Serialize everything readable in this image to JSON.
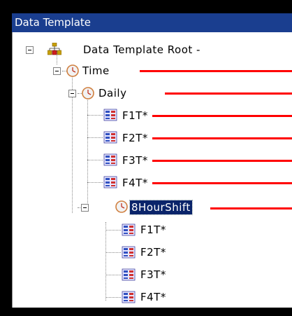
{
  "window": {
    "title": "Data Template"
  },
  "tree": {
    "root": {
      "label": "Data Template Root -",
      "expanded": true,
      "icon": "data-template-root-icon"
    },
    "time": {
      "label": "Time",
      "expanded": true,
      "icon": "clock-icon"
    },
    "daily": {
      "label": "Daily",
      "expanded": true,
      "icon": "clock-icon",
      "children": [
        "F1T*",
        "F2T*",
        "F3T*",
        "F4T*"
      ]
    },
    "shift": {
      "label": "8HourShift",
      "expanded": true,
      "selected": true,
      "icon": "clock-icon",
      "children": [
        "F1T*",
        "F2T*",
        "F3T*",
        "F4T*"
      ]
    }
  },
  "annotation_color": "#ff0000",
  "selection_color": "#0a246a",
  "titlebar_color": "#1a3e8f"
}
